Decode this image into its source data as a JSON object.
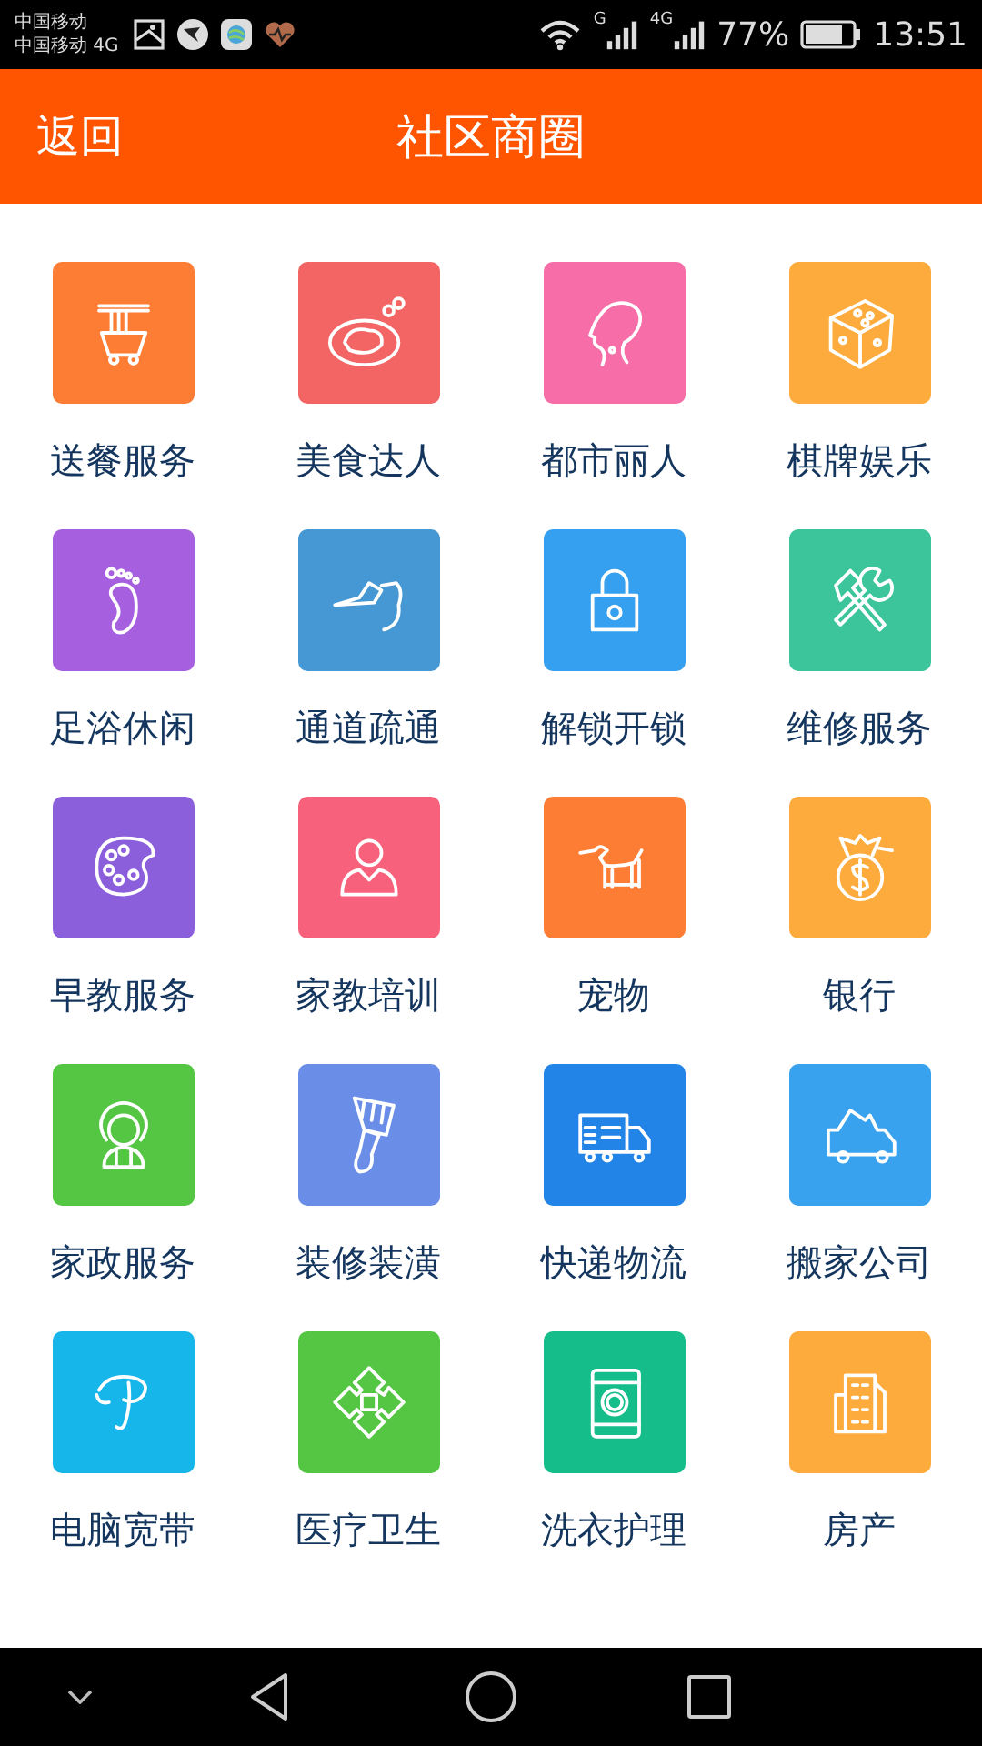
{
  "status_bar": {
    "carrier_1": "中国移动",
    "carrier_2": "中国移动 4G",
    "signal_1_label": "G",
    "signal_2_label": "4G",
    "battery": "77%",
    "time": "13:51"
  },
  "header": {
    "back": "返回",
    "title": "社区商圈"
  },
  "services": [
    {
      "label": "送餐服务",
      "kind": "noodles",
      "color": "#fe7d34"
    },
    {
      "label": "美食达人",
      "kind": "food",
      "color": "#f36565"
    },
    {
      "label": "都市丽人",
      "kind": "beauty",
      "color": "#f76da8"
    },
    {
      "label": "棋牌娱乐",
      "kind": "dice",
      "color": "#fdab3c"
    },
    {
      "label": "足浴休闲",
      "kind": "foot",
      "color": "#a65fdf"
    },
    {
      "label": "通道疏通",
      "kind": "pipe",
      "color": "#4598d3"
    },
    {
      "label": "解锁开锁",
      "kind": "lock",
      "color": "#34a0ef"
    },
    {
      "label": "维修服务",
      "kind": "tools",
      "color": "#3cc59b"
    },
    {
      "label": "早教服务",
      "kind": "palette",
      "color": "#8b5fdc"
    },
    {
      "label": "家教培训",
      "kind": "teacher",
      "color": "#f7617b"
    },
    {
      "label": "宠物",
      "kind": "dog",
      "color": "#fe7d34"
    },
    {
      "label": "银行",
      "kind": "moneybag",
      "color": "#fdab3c"
    },
    {
      "label": "家政服务",
      "kind": "housekeeper",
      "color": "#55c544"
    },
    {
      "label": "装修装潢",
      "kind": "brush",
      "color": "#6a8de8"
    },
    {
      "label": "快递物流",
      "kind": "truck",
      "color": "#2384e8"
    },
    {
      "label": "搬家公司",
      "kind": "moving",
      "color": "#38a2ee"
    },
    {
      "label": "电脑宽带",
      "kind": "telecom",
      "color": "#17b6ea"
    },
    {
      "label": "医疗卫生",
      "kind": "medical",
      "color": "#55c544"
    },
    {
      "label": "洗衣护理",
      "kind": "washer",
      "color": "#14bd8a"
    },
    {
      "label": "房产",
      "kind": "building",
      "color": "#fdab3c"
    }
  ]
}
